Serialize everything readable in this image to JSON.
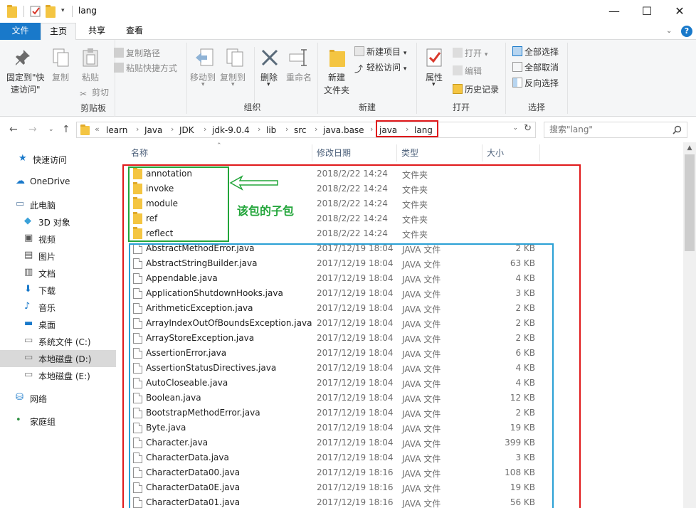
{
  "window": {
    "title": "lang",
    "minimize": "—",
    "maximize": "☐",
    "close": "✕"
  },
  "tabs": {
    "file": "文件",
    "home": "主页",
    "share": "共享",
    "view": "查看"
  },
  "ribbon": {
    "clipboard": {
      "label": "剪贴板",
      "pin": "固定到\"快",
      "pin2": "速访问\"",
      "copy": "复制",
      "paste": "粘贴",
      "copy_path": "复制路径",
      "paste_shortcut": "粘贴快捷方式",
      "cut": "剪切"
    },
    "organize": {
      "label": "组织",
      "move_to": "移动到",
      "copy_to": "复制到",
      "delete": "删除",
      "rename": "重命名"
    },
    "new": {
      "label": "新建",
      "new_folder": "新建",
      "new_folder2": "文件夹",
      "new_item": "新建项目",
      "easy_access": "轻松访问"
    },
    "open": {
      "label": "打开",
      "properties": "属性",
      "open": "打开",
      "edit": "编辑",
      "history": "历史记录"
    },
    "select": {
      "label": "选择",
      "select_all": "全部选择",
      "select_none": "全部取消",
      "invert": "反向选择"
    }
  },
  "address": {
    "crumbs": [
      "learn",
      "Java",
      "JDK",
      "jdk-9.0.4",
      "lib",
      "src",
      "java.base",
      "java",
      "lang"
    ],
    "overflow": "«",
    "search_placeholder": "搜索\"lang\""
  },
  "nav": [
    {
      "label": "快速访问",
      "icon": "star-icon"
    },
    {
      "label": "OneDrive",
      "icon": "cloud-icon"
    },
    {
      "label": "此电脑",
      "icon": "computer-icon"
    },
    {
      "label": "3D 对象",
      "icon": "cube-icon"
    },
    {
      "label": "视频",
      "icon": "video-icon"
    },
    {
      "label": "图片",
      "icon": "picture-icon"
    },
    {
      "label": "文档",
      "icon": "document-icon"
    },
    {
      "label": "下载",
      "icon": "download-icon"
    },
    {
      "label": "音乐",
      "icon": "music-icon"
    },
    {
      "label": "桌面",
      "icon": "desktop-icon"
    },
    {
      "label": "系统文件 (C:)",
      "icon": "drive-icon"
    },
    {
      "label": "本地磁盘 (D:)",
      "icon": "drive-icon",
      "selected": true
    },
    {
      "label": "本地磁盘 (E:)",
      "icon": "drive-icon"
    },
    {
      "label": "网络",
      "icon": "network-icon"
    },
    {
      "label": "家庭组",
      "icon": "homegroup-icon"
    }
  ],
  "columns": {
    "name": "名称",
    "date": "修改日期",
    "type": "类型",
    "size": "大小"
  },
  "files": [
    {
      "name": "annotation",
      "date": "2018/2/22 14:24",
      "type": "文件夹",
      "size": "",
      "folder": true
    },
    {
      "name": "invoke",
      "date": "2018/2/22 14:24",
      "type": "文件夹",
      "size": "",
      "folder": true
    },
    {
      "name": "module",
      "date": "2018/2/22 14:24",
      "type": "文件夹",
      "size": "",
      "folder": true
    },
    {
      "name": "ref",
      "date": "2018/2/22 14:24",
      "type": "文件夹",
      "size": "",
      "folder": true
    },
    {
      "name": "reflect",
      "date": "2018/2/22 14:24",
      "type": "文件夹",
      "size": "",
      "folder": true
    },
    {
      "name": "AbstractMethodError.java",
      "date": "2017/12/19 18:04",
      "type": "JAVA 文件",
      "size": "2 KB"
    },
    {
      "name": "AbstractStringBuilder.java",
      "date": "2017/12/19 18:04",
      "type": "JAVA 文件",
      "size": "63 KB"
    },
    {
      "name": "Appendable.java",
      "date": "2017/12/19 18:04",
      "type": "JAVA 文件",
      "size": "4 KB"
    },
    {
      "name": "ApplicationShutdownHooks.java",
      "date": "2017/12/19 18:04",
      "type": "JAVA 文件",
      "size": "3 KB"
    },
    {
      "name": "ArithmeticException.java",
      "date": "2017/12/19 18:04",
      "type": "JAVA 文件",
      "size": "2 KB"
    },
    {
      "name": "ArrayIndexOutOfBoundsException.java",
      "date": "2017/12/19 18:04",
      "type": "JAVA 文件",
      "size": "2 KB"
    },
    {
      "name": "ArrayStoreException.java",
      "date": "2017/12/19 18:04",
      "type": "JAVA 文件",
      "size": "2 KB"
    },
    {
      "name": "AssertionError.java",
      "date": "2017/12/19 18:04",
      "type": "JAVA 文件",
      "size": "6 KB"
    },
    {
      "name": "AssertionStatusDirectives.java",
      "date": "2017/12/19 18:04",
      "type": "JAVA 文件",
      "size": "4 KB"
    },
    {
      "name": "AutoCloseable.java",
      "date": "2017/12/19 18:04",
      "type": "JAVA 文件",
      "size": "4 KB"
    },
    {
      "name": "Boolean.java",
      "date": "2017/12/19 18:04",
      "type": "JAVA 文件",
      "size": "12 KB"
    },
    {
      "name": "BootstrapMethodError.java",
      "date": "2017/12/19 18:04",
      "type": "JAVA 文件",
      "size": "2 KB"
    },
    {
      "name": "Byte.java",
      "date": "2017/12/19 18:04",
      "type": "JAVA 文件",
      "size": "19 KB"
    },
    {
      "name": "Character.java",
      "date": "2017/12/19 18:04",
      "type": "JAVA 文件",
      "size": "399 KB"
    },
    {
      "name": "CharacterData.java",
      "date": "2017/12/19 18:04",
      "type": "JAVA 文件",
      "size": "3 KB"
    },
    {
      "name": "CharacterData00.java",
      "date": "2017/12/19 18:16",
      "type": "JAVA 文件",
      "size": "108 KB"
    },
    {
      "name": "CharacterData0E.java",
      "date": "2017/12/19 18:16",
      "type": "JAVA 文件",
      "size": "19 KB"
    },
    {
      "name": "CharacterData01.java",
      "date": "2017/12/19 18:16",
      "type": "JAVA 文件",
      "size": "56 KB"
    }
  ],
  "annotation": {
    "label": "该包的子包"
  },
  "colors": {
    "accent": "#1979ca",
    "red_box": "#e0191b",
    "green_box": "#22a53a",
    "blue_box": "#2aa0d5"
  }
}
